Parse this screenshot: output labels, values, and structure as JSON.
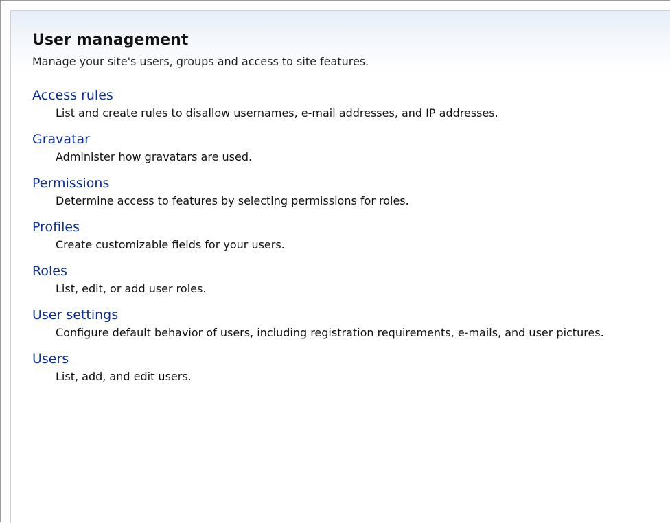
{
  "page": {
    "title": "User management",
    "description": "Manage your site's users, groups and access to site features."
  },
  "items": [
    {
      "label": "Access rules",
      "description": "List and create rules to disallow usernames, e-mail addresses, and IP addresses."
    },
    {
      "label": "Gravatar",
      "description": "Administer how gravatars are used."
    },
    {
      "label": "Permissions",
      "description": "Determine access to features by selecting permissions for roles."
    },
    {
      "label": "Profiles",
      "description": "Create customizable fields for your users."
    },
    {
      "label": "Roles",
      "description": "List, edit, or add user roles."
    },
    {
      "label": "User settings",
      "description": "Configure default behavior of users, including registration requirements, e-mails, and user pictures."
    },
    {
      "label": "Users",
      "description": "List, add, and edit users."
    }
  ],
  "colors": {
    "link": "#0b2f98",
    "text": "#111111",
    "background": "#ffffff",
    "header_tint": "#e6eef8"
  }
}
